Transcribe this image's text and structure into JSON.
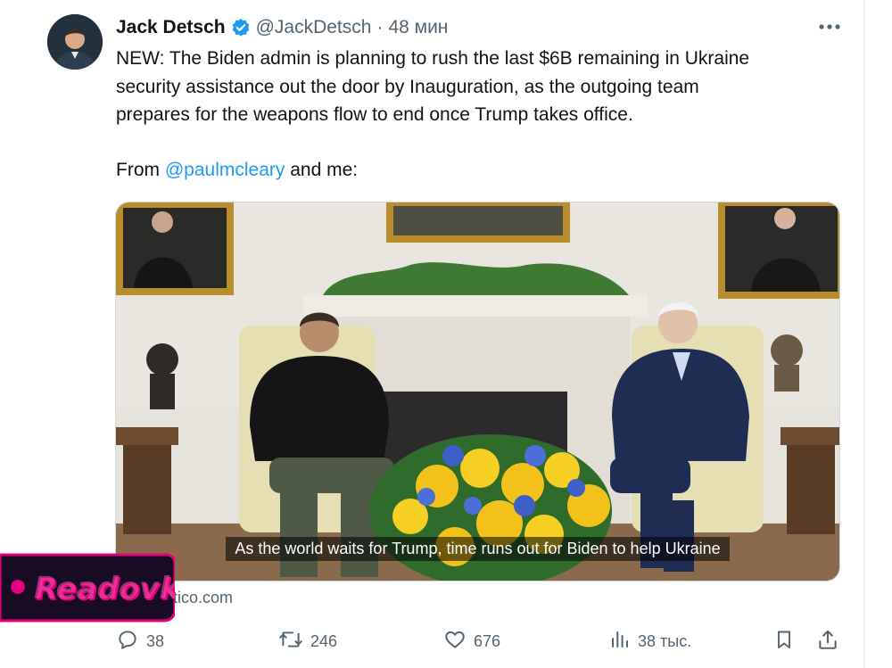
{
  "tweet": {
    "author_name": "Jack Detsch",
    "handle": "@JackDetsch",
    "separator": "·",
    "time": "48 мин",
    "text_lines": [
      "NEW: The Biden admin is planning to rush the last $6B remaining in Ukraine",
      "security assistance out the door by Inauguration, as the outgoing team",
      "prepares for the weapons flow to end once Trump takes office."
    ],
    "from_prefix": "From",
    "from_mention": "@paulmcleary",
    "from_suffix": "and me:"
  },
  "media": {
    "caption": "As the world waits for Trump, time runs out for Biden to help Ukraine"
  },
  "link": {
    "domain_visible": "itico.com"
  },
  "watermark": {
    "text": "Readovka"
  },
  "actions": {
    "replies": "38",
    "retweets": "246",
    "likes": "676",
    "views": "38 тыс."
  },
  "icons": {
    "verified": "verified-badge-icon",
    "more": "more-options-icon",
    "reply": "reply-icon",
    "retweet": "retweet-icon",
    "like": "heart-icon",
    "views": "views-chart-icon",
    "bookmark": "bookmark-icon",
    "share": "share-icon"
  },
  "colors": {
    "accent": "#1d9bf0",
    "secondary_text": "#536471",
    "primary_text": "#0f1419",
    "watermark_pink": "#e4007c"
  }
}
